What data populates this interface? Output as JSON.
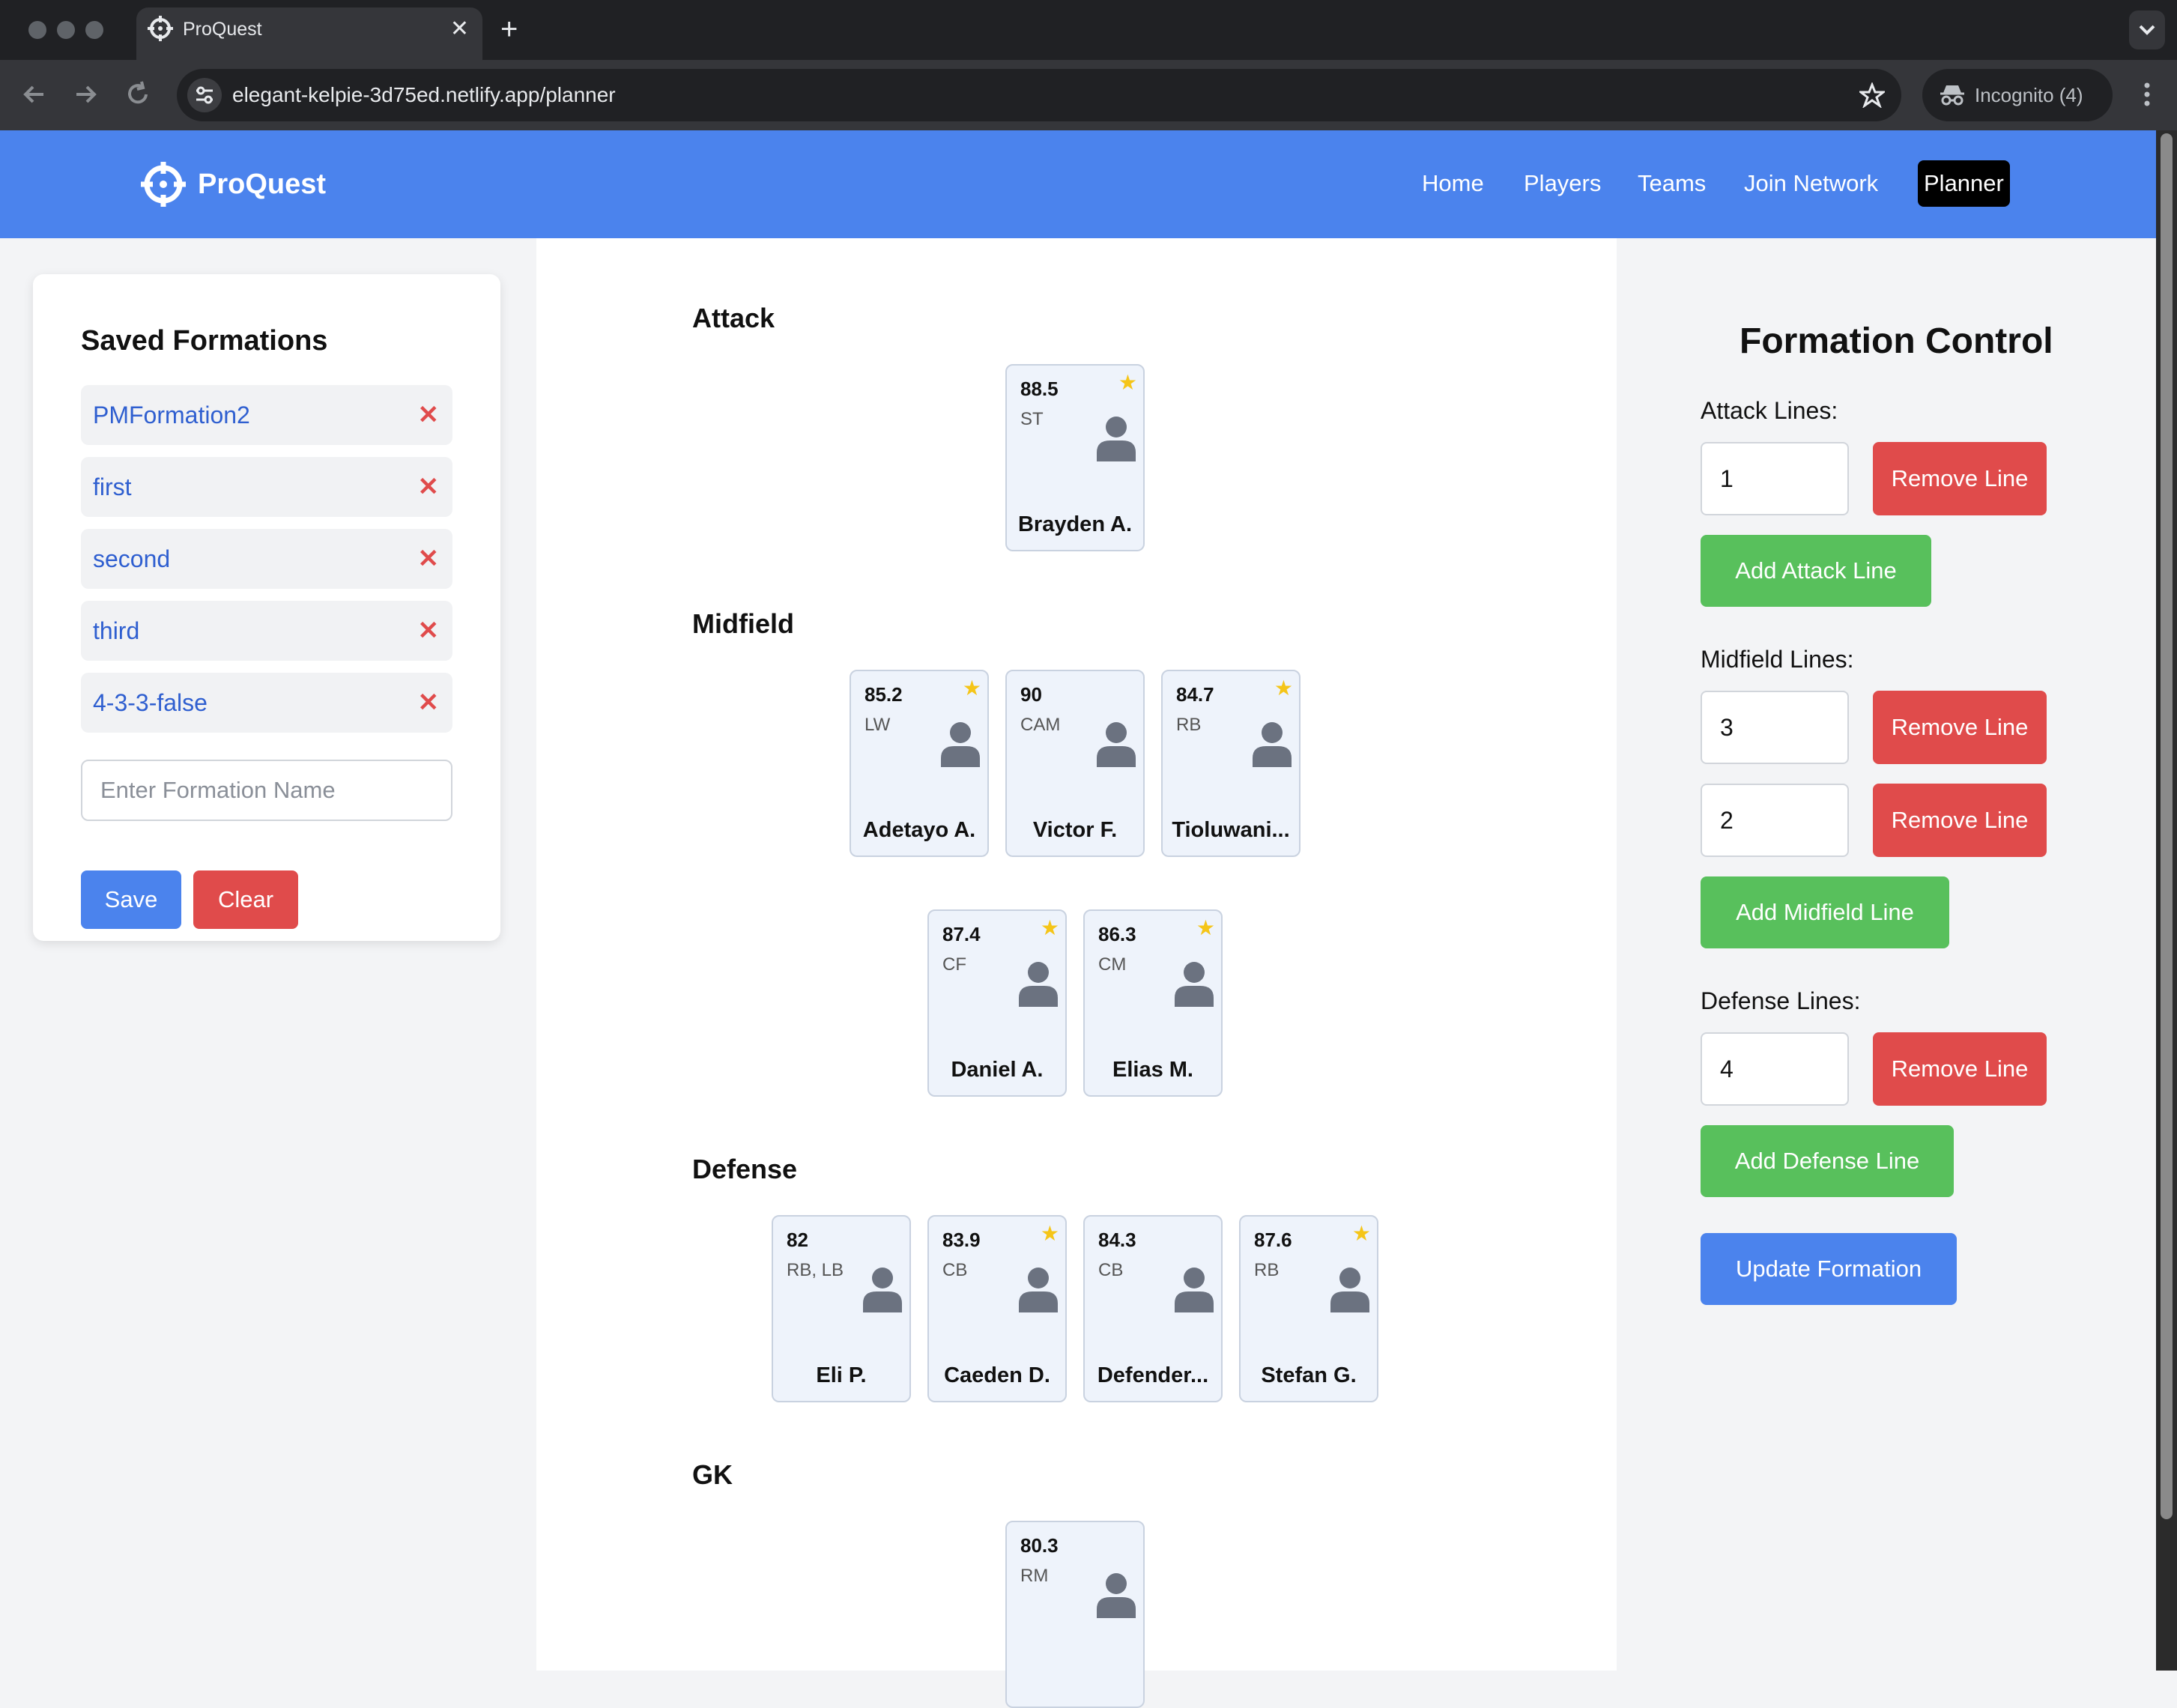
{
  "browser": {
    "tab_title": "ProQuest",
    "url": "elegant-kelpie-3d75ed.netlify.app/planner",
    "incognito_label": "Incognito (4)",
    "new_tab_glyph": "+",
    "close_glyph": "✕"
  },
  "header": {
    "brand": "ProQuest",
    "nav": [
      "Home",
      "Players",
      "Teams",
      "Join Network",
      "Planner"
    ],
    "active": "Planner"
  },
  "saved": {
    "title": "Saved Formations",
    "items": [
      "PMFormation2",
      "first",
      "second",
      "third",
      "4-3-3-false"
    ],
    "delete_glyph": "✕",
    "input_placeholder": "Enter Formation Name",
    "save_label": "Save",
    "clear_label": "Clear"
  },
  "field": {
    "attack_title": "Attack",
    "midfield_title": "Midfield",
    "defense_title": "Defense",
    "gk_title": "GK",
    "attack": [
      {
        "rating": "88.5",
        "pos": "ST",
        "name": "Brayden A.",
        "star": true
      }
    ],
    "midfield1": [
      {
        "rating": "85.2",
        "pos": "LW",
        "name": "Adetayo A.",
        "star": true
      },
      {
        "rating": "90",
        "pos": "CAM",
        "name": "Victor F.",
        "star": false
      },
      {
        "rating": "84.7",
        "pos": "RB",
        "name": "Tioluwani...",
        "star": true
      }
    ],
    "midfield2": [
      {
        "rating": "87.4",
        "pos": "CF",
        "name": "Daniel A.",
        "star": true
      },
      {
        "rating": "86.3",
        "pos": "CM",
        "name": "Elias M.",
        "star": true
      }
    ],
    "defense": [
      {
        "rating": "82",
        "pos": "RB, LB",
        "name": "Eli P.",
        "star": false
      },
      {
        "rating": "83.9",
        "pos": "CB",
        "name": "Caeden D.",
        "star": true
      },
      {
        "rating": "84.3",
        "pos": "CB",
        "name": "Defender...",
        "star": false
      },
      {
        "rating": "87.6",
        "pos": "RB",
        "name": "Stefan G.",
        "star": true
      }
    ],
    "gk": [
      {
        "rating": "80.3",
        "pos": "RM",
        "name": "",
        "star": false
      }
    ]
  },
  "control": {
    "title": "Formation Control",
    "attack_label": "Attack Lines:",
    "midfield_label": "Midfield Lines:",
    "defense_label": "Defense Lines:",
    "attack_lines": [
      "1"
    ],
    "midfield_lines": [
      "3",
      "2"
    ],
    "defense_lines": [
      "4"
    ],
    "remove_label": "Remove Line",
    "add_attack_label": "Add Attack Line",
    "add_midfield_label": "Add Midfield Line",
    "add_defense_label": "Add Defense Line",
    "update_label": "Update Formation"
  },
  "colors": {
    "header_blue": "#4b83ed",
    "danger_red": "#e04b4b",
    "success_green": "#58c05c",
    "star_gold": "#f5c518"
  }
}
